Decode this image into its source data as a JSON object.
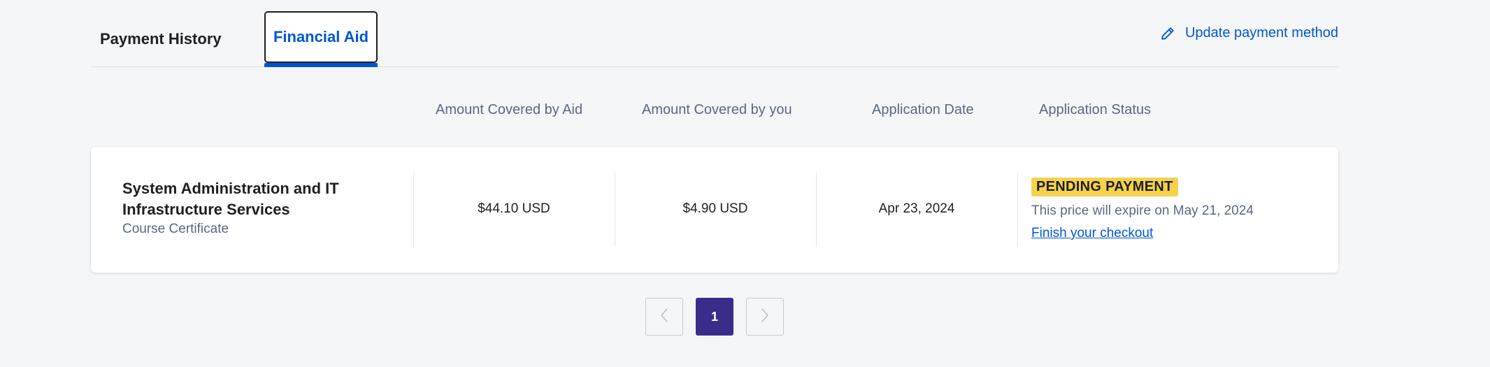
{
  "tabs": {
    "payment_history": "Payment History",
    "financial_aid": "Financial Aid",
    "active": "financial_aid"
  },
  "actions": {
    "update_payment_method": "Update payment method",
    "update_icon": "pencil-icon"
  },
  "table": {
    "headers": {
      "amount_aid": "Amount Covered by Aid",
      "amount_you": "Amount Covered by you",
      "application_date": "Application Date",
      "application_status": "Application Status"
    },
    "rows": [
      {
        "course_title": "System Administration and IT Infrastructure Services",
        "course_type": "Course Certificate",
        "amount_aid": "$44.10 USD",
        "amount_you": "$4.90 USD",
        "application_date": "Apr 23, 2024",
        "status_badge": "PENDING PAYMENT",
        "status_note": "This price will expire on May 21, 2024",
        "status_link": "Finish your checkout"
      }
    ]
  },
  "pagination": {
    "current_page": "1",
    "prev_icon": "chevron-left-icon",
    "next_icon": "chevron-right-icon"
  },
  "colors": {
    "accent": "#0056d2",
    "badge": "#f4d24e",
    "pager_active": "#382d8b",
    "background": "#f5f6f8"
  }
}
